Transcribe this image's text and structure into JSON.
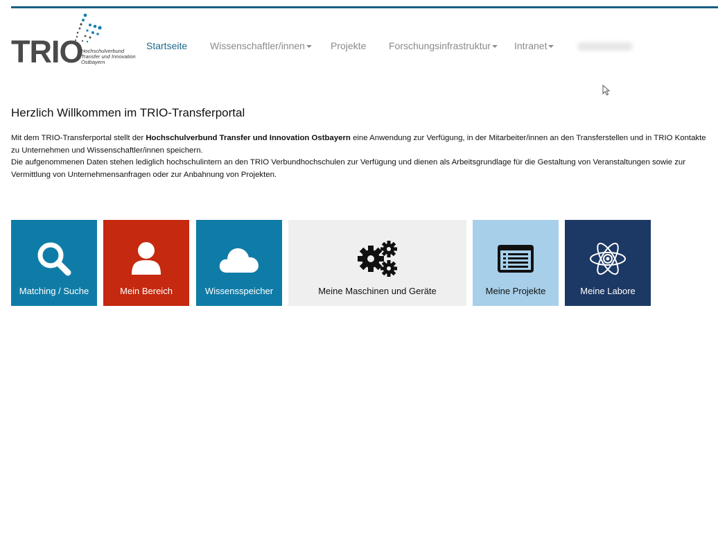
{
  "logo": {
    "word": "TRIO",
    "subtitle_lines": [
      "Hochschulverbund",
      "Transfer und Innovation",
      "Ostbayern"
    ]
  },
  "nav": {
    "items": [
      {
        "label": "Startseite",
        "active": true,
        "dropdown": false
      },
      {
        "label": "Wissenschaftler/innen",
        "active": false,
        "dropdown": true
      },
      {
        "label": "Projekte",
        "active": false,
        "dropdown": false
      },
      {
        "label": "Forschungsinfrastruktur",
        "active": false,
        "dropdown": true
      },
      {
        "label": "Intranet",
        "active": false,
        "dropdown": true
      }
    ]
  },
  "main": {
    "heading": "Herzlich Willkommen im TRIO-Transferportal",
    "intro": {
      "p1_before": "Mit dem TRIO-Transferportal stellt der ",
      "p1_bold": "Hochschulverbund Transfer und Innovation Ostbayern",
      "p1_after": " eine Anwendung zur Verfügung, in der Mitarbeiter/innen an den Transferstellen und in TRIO Kontakte zu Unternehmen und Wissenschaftler/innen speichern.",
      "p2": "Die aufgenommenen Daten stehen lediglich hochschulintern an den TRIO Verbundhochschulen zur Verfügung und dienen als Arbeitsgrundlage für die Gestaltung von Veranstaltungen sowie zur Vermittlung von Unternehmensanfragen oder zur Anbahnung von Projekten."
    }
  },
  "tiles": [
    {
      "label": "Matching / Suche",
      "icon": "search-icon",
      "color": "#0f7ca7"
    },
    {
      "label": "Mein Bereich",
      "icon": "user-icon",
      "color": "#c5290f"
    },
    {
      "label": "Wissensspeicher",
      "icon": "cloud-icon",
      "color": "#0f7ca7"
    },
    {
      "label": "Meine Maschinen und Geräte",
      "icon": "gears-icon",
      "color": "#efefef"
    },
    {
      "label": "Meine Projekte",
      "icon": "list-icon",
      "color": "#a7cfe9"
    },
    {
      "label": "Meine Labore",
      "icon": "atom-icon",
      "color": "#1c3864"
    }
  ],
  "colors": {
    "accent": "#1c6a8c",
    "top_rule": "#1a5e86",
    "nav_text": "#8a8a8a"
  }
}
